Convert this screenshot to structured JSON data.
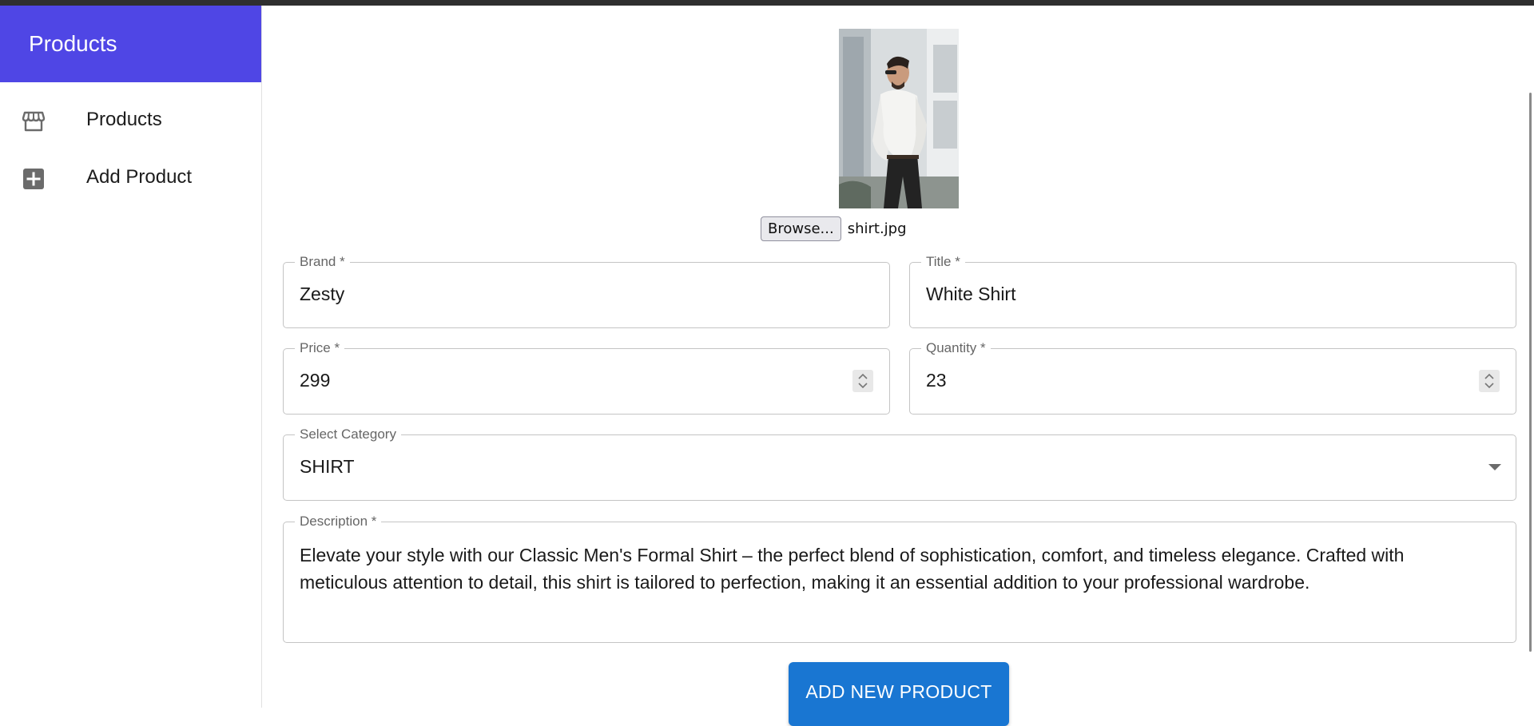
{
  "sidebar": {
    "title": "Products",
    "items": [
      {
        "label": "Products",
        "icon": "storefront-icon"
      },
      {
        "label": "Add Product",
        "icon": "add-box-icon"
      }
    ]
  },
  "form": {
    "image": {
      "alt": "Product preview: man in white shirt",
      "file_name": "shirt.jpg",
      "browse_label": "Browse..."
    },
    "brand": {
      "label": "Brand *",
      "value": "Zesty"
    },
    "title": {
      "label": "Title *",
      "value": "White Shirt"
    },
    "price": {
      "label": "Price *",
      "value": "299"
    },
    "quantity": {
      "label": "Quantity *",
      "value": "23"
    },
    "category": {
      "label": "Select Category",
      "value": "SHIRT"
    },
    "description": {
      "label": "Description *",
      "value": "Elevate your style with our Classic Men's Formal Shirt – the perfect blend of sophistication, comfort, and timeless elegance. Crafted with meticulous attention to detail, this shirt is tailored to perfection, making it an essential addition to your professional wardrobe."
    },
    "submit_label": "ADD NEW PRODUCT"
  },
  "colors": {
    "sidebar_header": "#4f46e5",
    "primary_button": "#1976d2",
    "border": "#c4c4c4"
  }
}
